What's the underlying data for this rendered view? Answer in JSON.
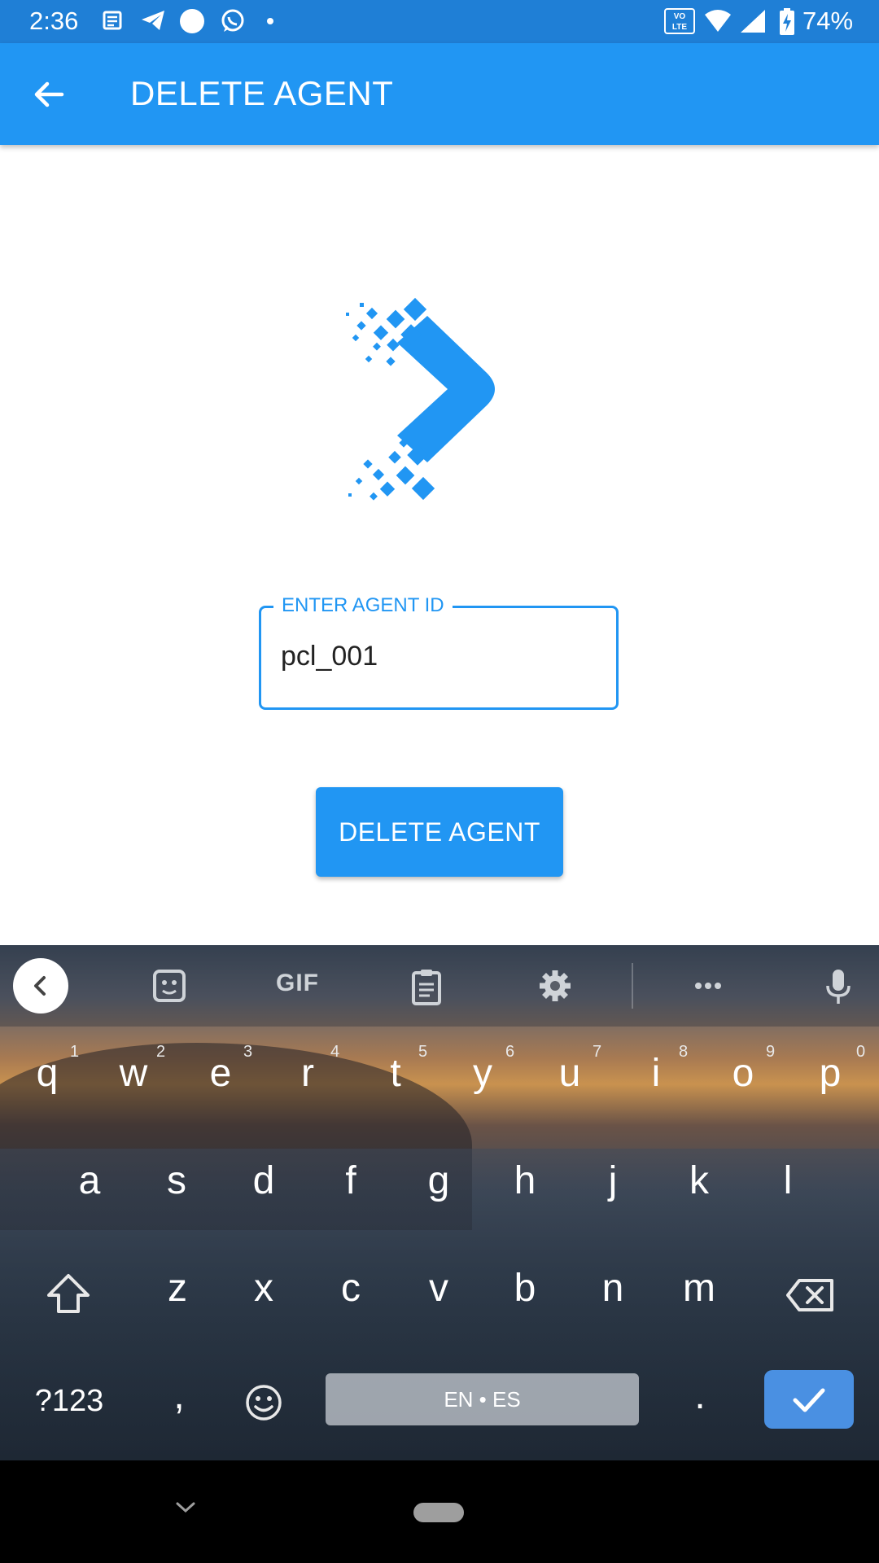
{
  "status_bar": {
    "time": "2:36",
    "battery": "74%",
    "network_badge": "VO LTE"
  },
  "app_bar": {
    "title": "DELETE AGENT"
  },
  "form": {
    "label": "ENTER AGENT ID",
    "value": "pcl_001"
  },
  "primary_button": {
    "label": "DELETE AGENT"
  },
  "keyboard": {
    "toolbar": {
      "gif_label": "GIF"
    },
    "row1": [
      "q",
      "w",
      "e",
      "r",
      "t",
      "y",
      "u",
      "i",
      "o",
      "p"
    ],
    "row1_hints": [
      "1",
      "2",
      "3",
      "4",
      "5",
      "6",
      "7",
      "8",
      "9",
      "0"
    ],
    "row2": [
      "a",
      "s",
      "d",
      "f",
      "g",
      "h",
      "j",
      "k",
      "l"
    ],
    "row3": [
      "z",
      "x",
      "c",
      "v",
      "b",
      "n",
      "m"
    ],
    "symbols_label": "?123",
    "comma": ",",
    "period": ".",
    "space_label": "EN • ES"
  },
  "colors": {
    "primary": "#2196f3",
    "status_bar": "#1f7fd6",
    "enter_key": "#4a90e2"
  }
}
